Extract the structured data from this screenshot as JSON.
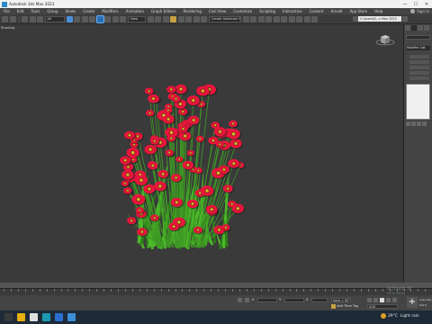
{
  "window": {
    "title": "Autodesk 3ds Max 2023",
    "controls": [
      "—",
      "☐",
      "✕"
    ]
  },
  "menus": [
    "File",
    "Edit",
    "Tools",
    "Group",
    "Views",
    "Create",
    "Modifiers",
    "Animation",
    "Graph Editors",
    "Rendering",
    "Civil View",
    "Customize",
    "Scripting",
    "Interactive",
    "Content",
    "Arnold",
    "App Store",
    "Help"
  ],
  "signin": {
    "label": "Sign In"
  },
  "toolbar": {
    "undo_icon": "undo-icon",
    "redo_icon": "redo-icon",
    "filter_value": "All",
    "refcoord_value": "View",
    "selection_set_placeholder": "Create Selection Se",
    "workspace_value": "C:\\Users\\D...s Max 2023"
  },
  "viewport": {
    "label": "[Perspective] [Standard] [Default Shading]",
    "label_short": "Shading"
  },
  "command_panel": {
    "modifier_list": "Modifier List"
  },
  "statusbar": {
    "time_value": "0:00",
    "frame_value": "0 / 100",
    "fov_value": "0mm = 90°",
    "autokey": "Auto Key",
    "selected": "Selected",
    "set_key": "Set K.",
    "key_filters": "Key Filters...",
    "add_time_tag": "Add Time Tag"
  },
  "activate": {
    "line1": "Activate W",
    "line2": "Go to Settin"
  },
  "taskbar": {
    "temp": "29°C",
    "weather": "Light rain"
  },
  "colors": {
    "viewport_bg": "#3a3a3a",
    "flower_red": "#e8143c",
    "leaf_green": "#4cb82a"
  }
}
